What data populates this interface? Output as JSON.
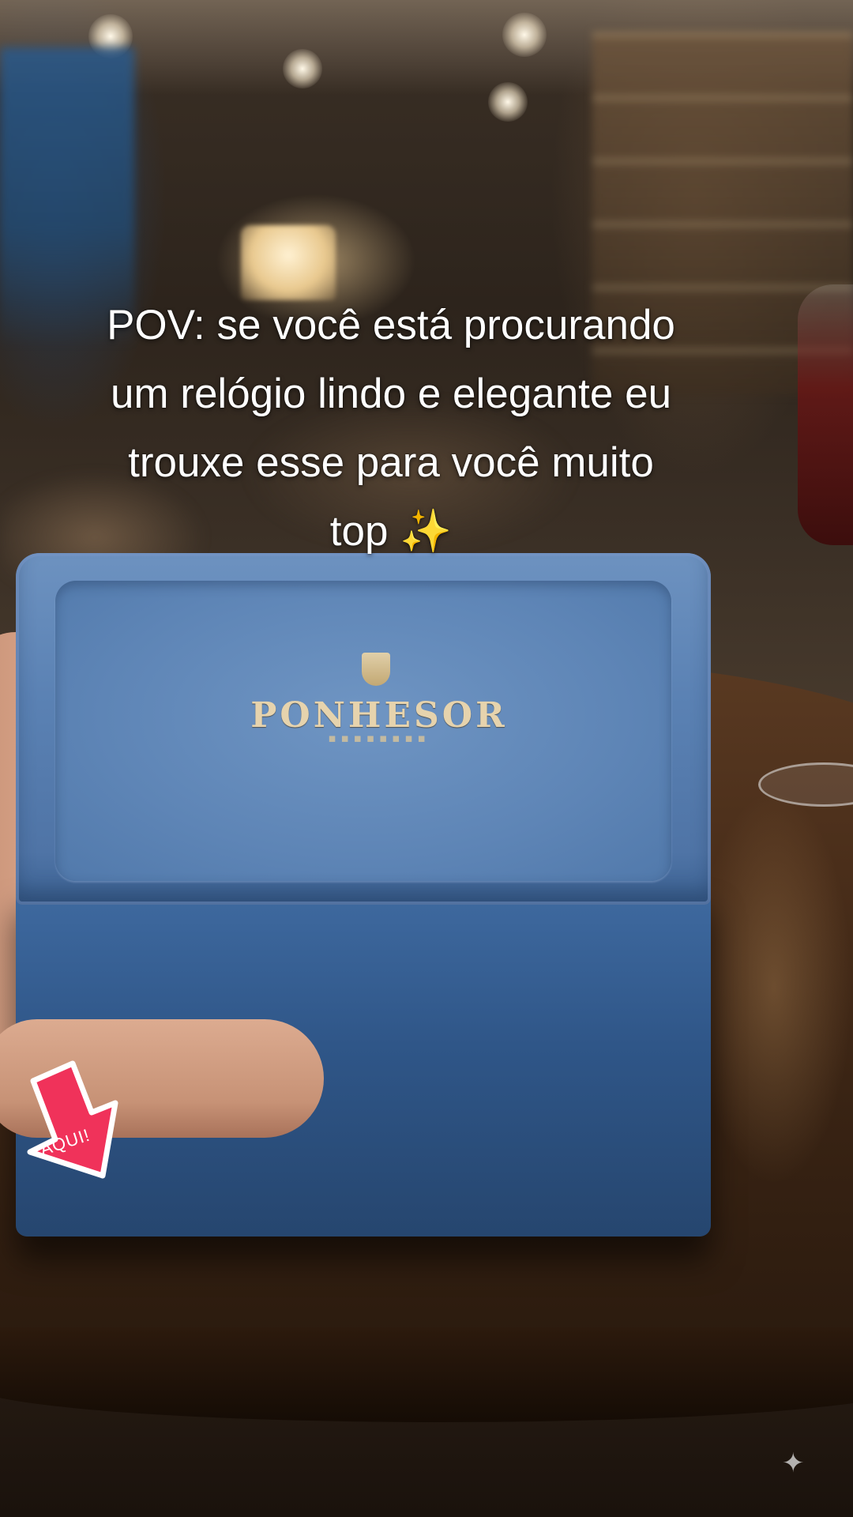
{
  "caption": {
    "line1": "POV: se você está procurando",
    "line2": "um relógio lindo e elegante eu",
    "line3": "trouxe esse para você muito",
    "line4": "top ✨"
  },
  "box": {
    "brand": "PONHESOR",
    "color": "#5b82b4"
  },
  "sticker": {
    "label": "AQUI!",
    "color": "#f0325a"
  },
  "corner_icon": "sparkle-icon"
}
